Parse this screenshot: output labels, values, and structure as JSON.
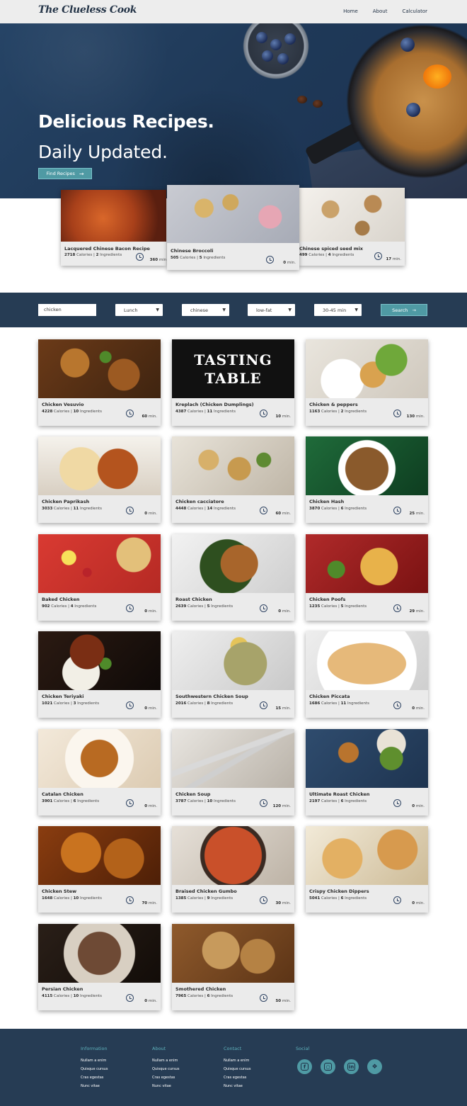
{
  "nav": {
    "logo": "The Clueless Cook",
    "links": [
      "Home",
      "About",
      "Calculator"
    ]
  },
  "hero": {
    "title": "Delicious Recipes.",
    "subtitle": "Daily Updated.",
    "button": "Find Recipes"
  },
  "featured": [
    {
      "name": "Lacquered Chinese Bacon Recipe",
      "calories": "2718",
      "ingredients": "2",
      "minutes": "360"
    },
    {
      "name": "Chinese Broccoli",
      "calories": "505",
      "ingredients": "5",
      "minutes": "0"
    },
    {
      "name": "Chinese spiced seed mix",
      "calories": "499",
      "ingredients": "4",
      "minutes": "17"
    }
  ],
  "search": {
    "query": "chicken",
    "meal": "Lunch",
    "cuisine": "chinese",
    "diet": "low-fat",
    "time": "30-45 min",
    "button": "Search"
  },
  "labels": {
    "calories": "Calories",
    "ingredients": "Ingredients",
    "min": "min.",
    "sep": "|"
  },
  "recipes": [
    {
      "name": "Chicken Vesuvio",
      "calories": "4228",
      "ingredients": "10",
      "minutes": "60"
    },
    {
      "name": "Kreplach (Chicken Dumplings)",
      "calories": "4387",
      "ingredients": "11",
      "minutes": "10"
    },
    {
      "name": "Chicken & peppers",
      "calories": "1163",
      "ingredients": "2",
      "minutes": "130"
    },
    {
      "name": "Chicken Paprikash",
      "calories": "3033",
      "ingredients": "11",
      "minutes": "0"
    },
    {
      "name": "Chicken cacciatore",
      "calories": "4448",
      "ingredients": "14",
      "minutes": "60"
    },
    {
      "name": "Chicken Hash",
      "calories": "3870",
      "ingredients": "6",
      "minutes": "25"
    },
    {
      "name": "Baked Chicken",
      "calories": "902",
      "ingredients": "4",
      "minutes": "0"
    },
    {
      "name": "Roast Chicken",
      "calories": "2639",
      "ingredients": "5",
      "minutes": "0"
    },
    {
      "name": "Chicken Poofs",
      "calories": "1235",
      "ingredients": "5",
      "minutes": "29"
    },
    {
      "name": "Chicken Teriyaki",
      "calories": "1021",
      "ingredients": "3",
      "minutes": "0"
    },
    {
      "name": "Southwestern Chicken Soup",
      "calories": "2016",
      "ingredients": "8",
      "minutes": "15"
    },
    {
      "name": "Chicken Piccata",
      "calories": "1686",
      "ingredients": "11",
      "minutes": "0"
    },
    {
      "name": "Catalan Chicken",
      "calories": "3901",
      "ingredients": "6",
      "minutes": "0"
    },
    {
      "name": "Chicken Soup",
      "calories": "3787",
      "ingredients": "10",
      "minutes": "120"
    },
    {
      "name": "Ultimate Roast Chicken",
      "calories": "2197",
      "ingredients": "6",
      "minutes": "0"
    },
    {
      "name": "Chicken Stew",
      "calories": "1648",
      "ingredients": "10",
      "minutes": "70"
    },
    {
      "name": "Braised Chicken Gumbo",
      "calories": "1385",
      "ingredients": "9",
      "minutes": "30"
    },
    {
      "name": "Crispy Chicken Dippers",
      "calories": "5041",
      "ingredients": "6",
      "minutes": "0"
    },
    {
      "name": "Persian Chicken",
      "calories": "4115",
      "ingredients": "10",
      "minutes": "0"
    },
    {
      "name": "Smothered Chicken",
      "calories": "7965",
      "ingredients": "6",
      "minutes": "50"
    }
  ],
  "tasting_table": [
    "TASTING",
    "TABLE"
  ],
  "footer": {
    "columns": [
      {
        "title": "Information",
        "links": [
          "Nullam a enim",
          "Quisque cursus",
          "Cras egestas",
          "Nunc vitae"
        ]
      },
      {
        "title": "About",
        "links": [
          "Nullam a enim",
          "Quisque cursus",
          "Cras egestas",
          "Nunc vitae"
        ]
      },
      {
        "title": "Contact",
        "links": [
          "Nullam a enim",
          "Quisque cursus",
          "Cras egestas",
          "Nunc vitae"
        ]
      }
    ],
    "social_title": "Social",
    "social_icons": [
      "facebook-icon",
      "instagram-icon",
      "linkedin-icon",
      "twitter-icon"
    ]
  },
  "colors": {
    "navy": "#263c54",
    "accent": "#4f9aa4",
    "nav_bg": "#ededed",
    "card_bg": "#ebebeb"
  }
}
